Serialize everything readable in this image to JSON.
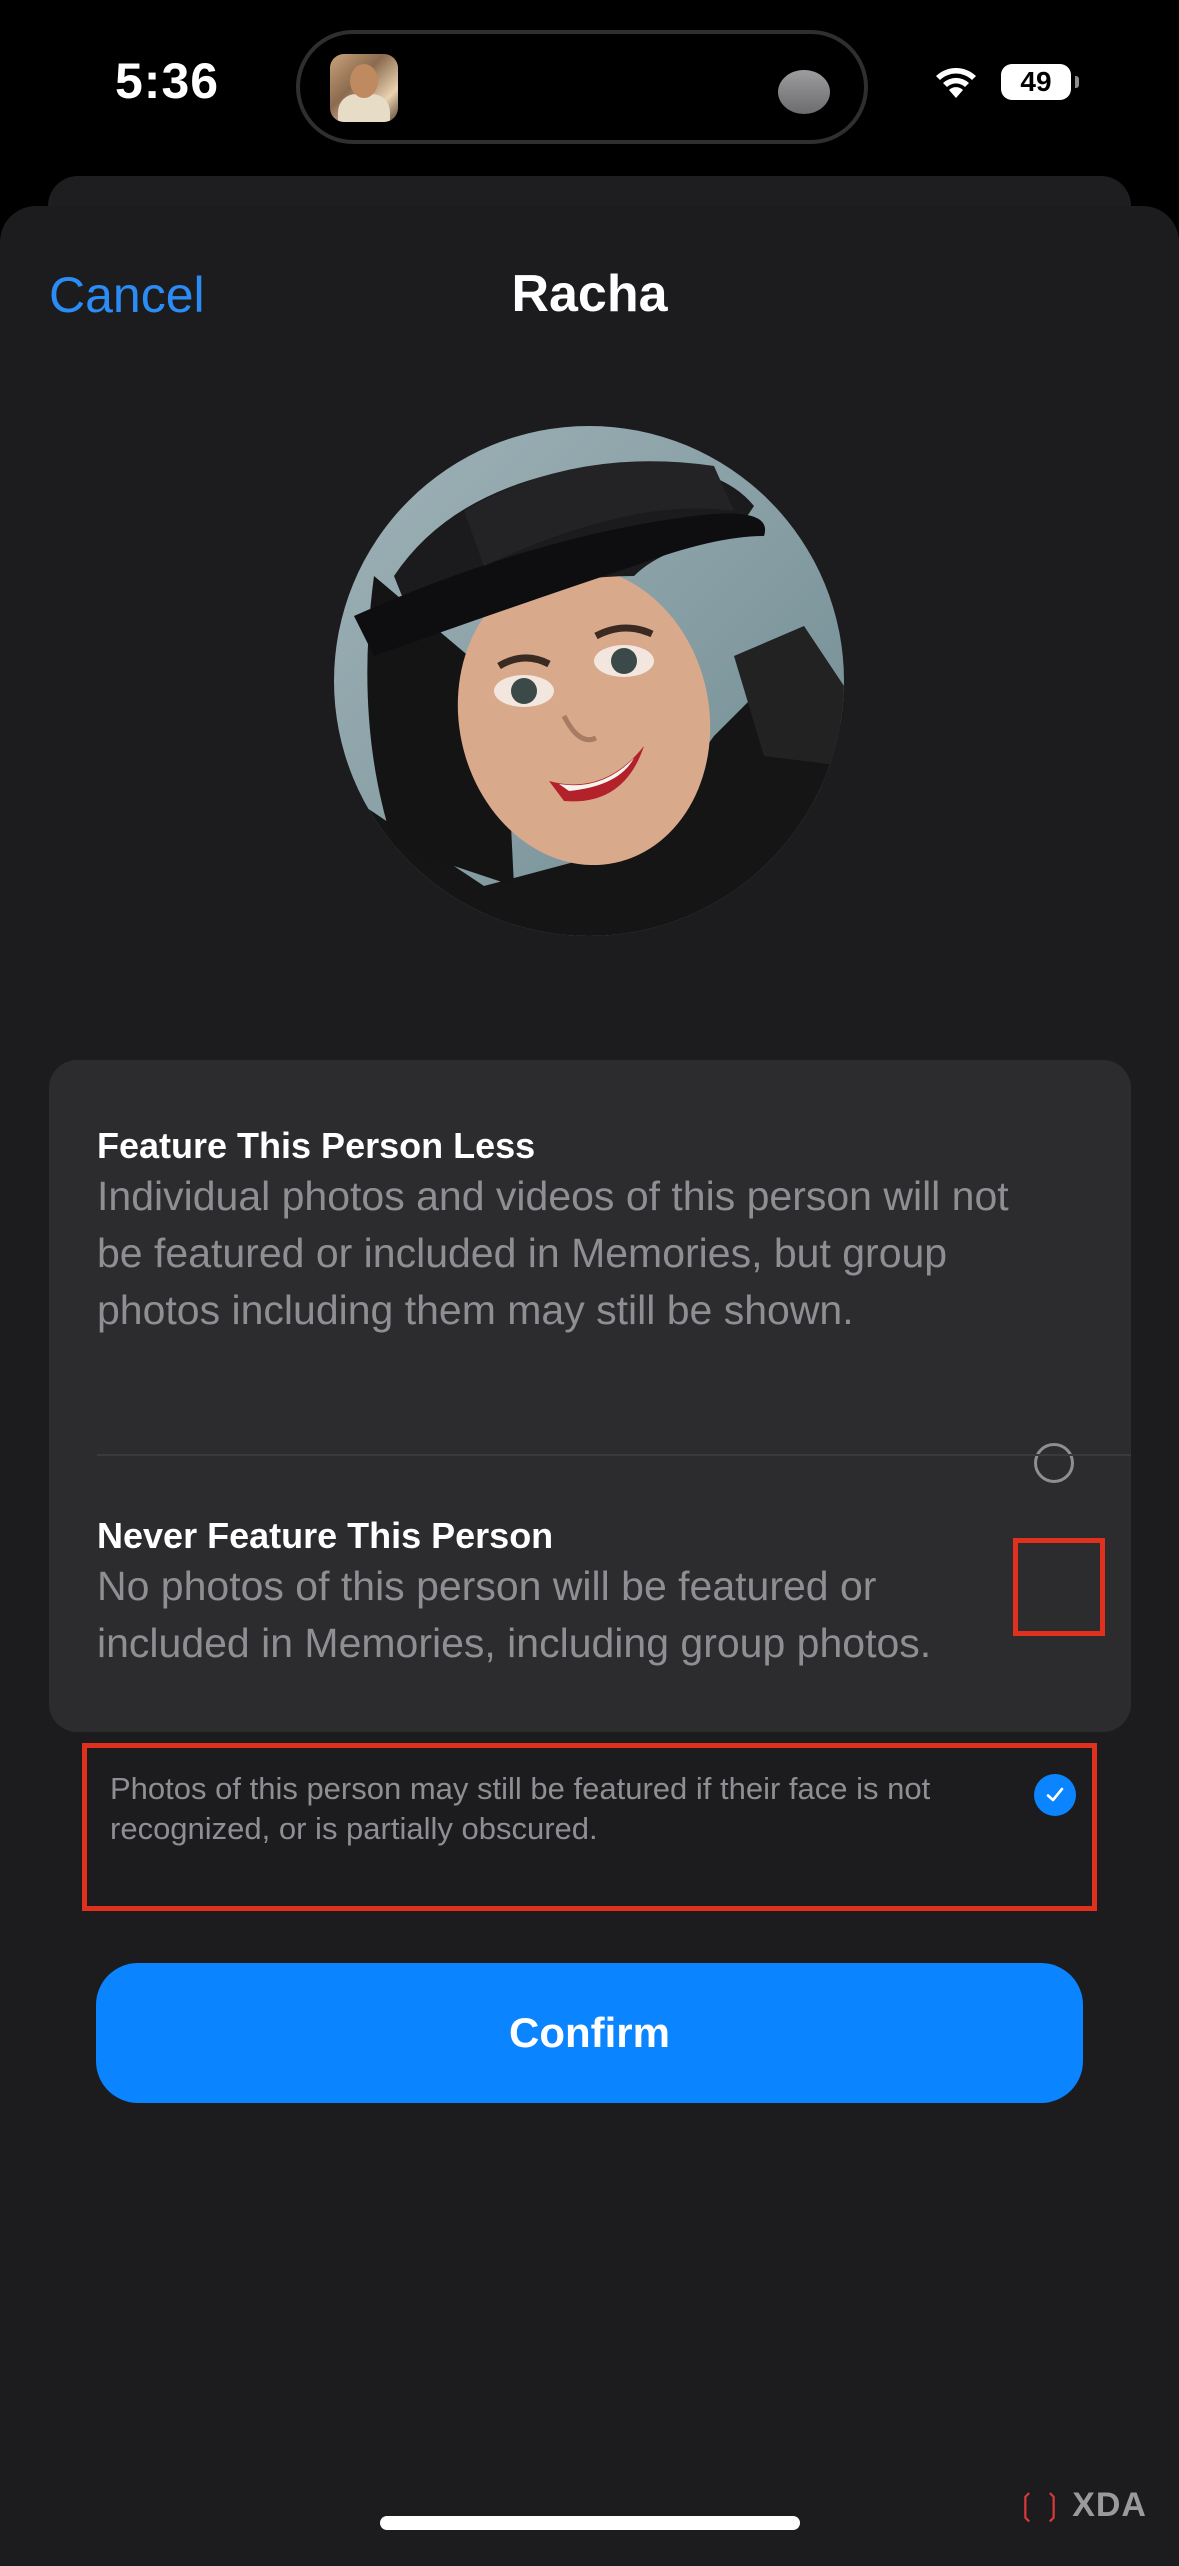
{
  "status_bar": {
    "time": "5:36",
    "battery_level": "49",
    "icons": [
      "wifi-icon",
      "battery-icon"
    ]
  },
  "sheet": {
    "cancel_label": "Cancel",
    "title": "Racha"
  },
  "options": [
    {
      "title": "Feature This Person Less",
      "description": "Individual photos and videos of this person will not be featured or included in Memories, but group photos including them may still be shown.",
      "selected": false
    },
    {
      "title": "Never Feature This Person",
      "description": "No photos of this person will be featured or included in Memories, including group photos.",
      "selected": true
    }
  ],
  "footnote": "Photos of this person may still be featured if their face is not recognized, or is partially obscured.",
  "confirm_label": "Confirm",
  "watermark": "XDA",
  "colors": {
    "accent": "#0a84ff",
    "link": "#2b8cf5",
    "sheet_bg": "#1c1c1e",
    "card_bg": "#2c2c2e",
    "highlight": "#e0301e"
  }
}
